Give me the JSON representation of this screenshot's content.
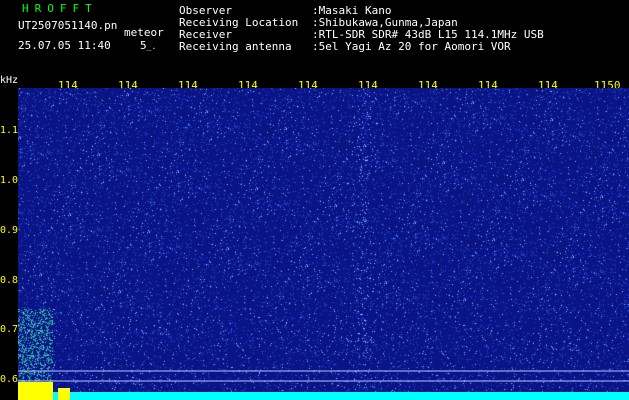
{
  "header": {
    "brand": "HROFFT",
    "filename": "UT2507051140.pn",
    "meteor_label": "meteor",
    "datetime": "25.07.05 11:40",
    "count": "5"
  },
  "info": {
    "rows": [
      {
        "label": "Observer",
        "value": ":Masaki Kano"
      },
      {
        "label": "Receiving Location",
        "value": ":Shibukawa,Gunma,Japan"
      },
      {
        "label": "Receiver",
        "value": ":RTL-SDR SDR# 43dB L15 114.1MHz USB"
      },
      {
        "label": "Receiving antenna",
        "value": ":5el Yagi Az 20 for Aomori VOR"
      }
    ]
  },
  "axes": {
    "y_unit": "kHz",
    "y_ticks": [
      "1.1",
      "1.0",
      "0.9",
      "0.8",
      "0.7",
      "0.6"
    ],
    "x_ticks": [
      "114",
      "114",
      "114",
      "114",
      "114",
      "114",
      "114",
      "114",
      "114",
      "1150"
    ]
  },
  "colors": {
    "background": "#000000",
    "spectrogram_base": "#0d1a8a",
    "tick_text": "#ffff00",
    "brand": "#00ff00",
    "baseline": "#00ffff",
    "meteor_echo": "#ffff00"
  }
}
